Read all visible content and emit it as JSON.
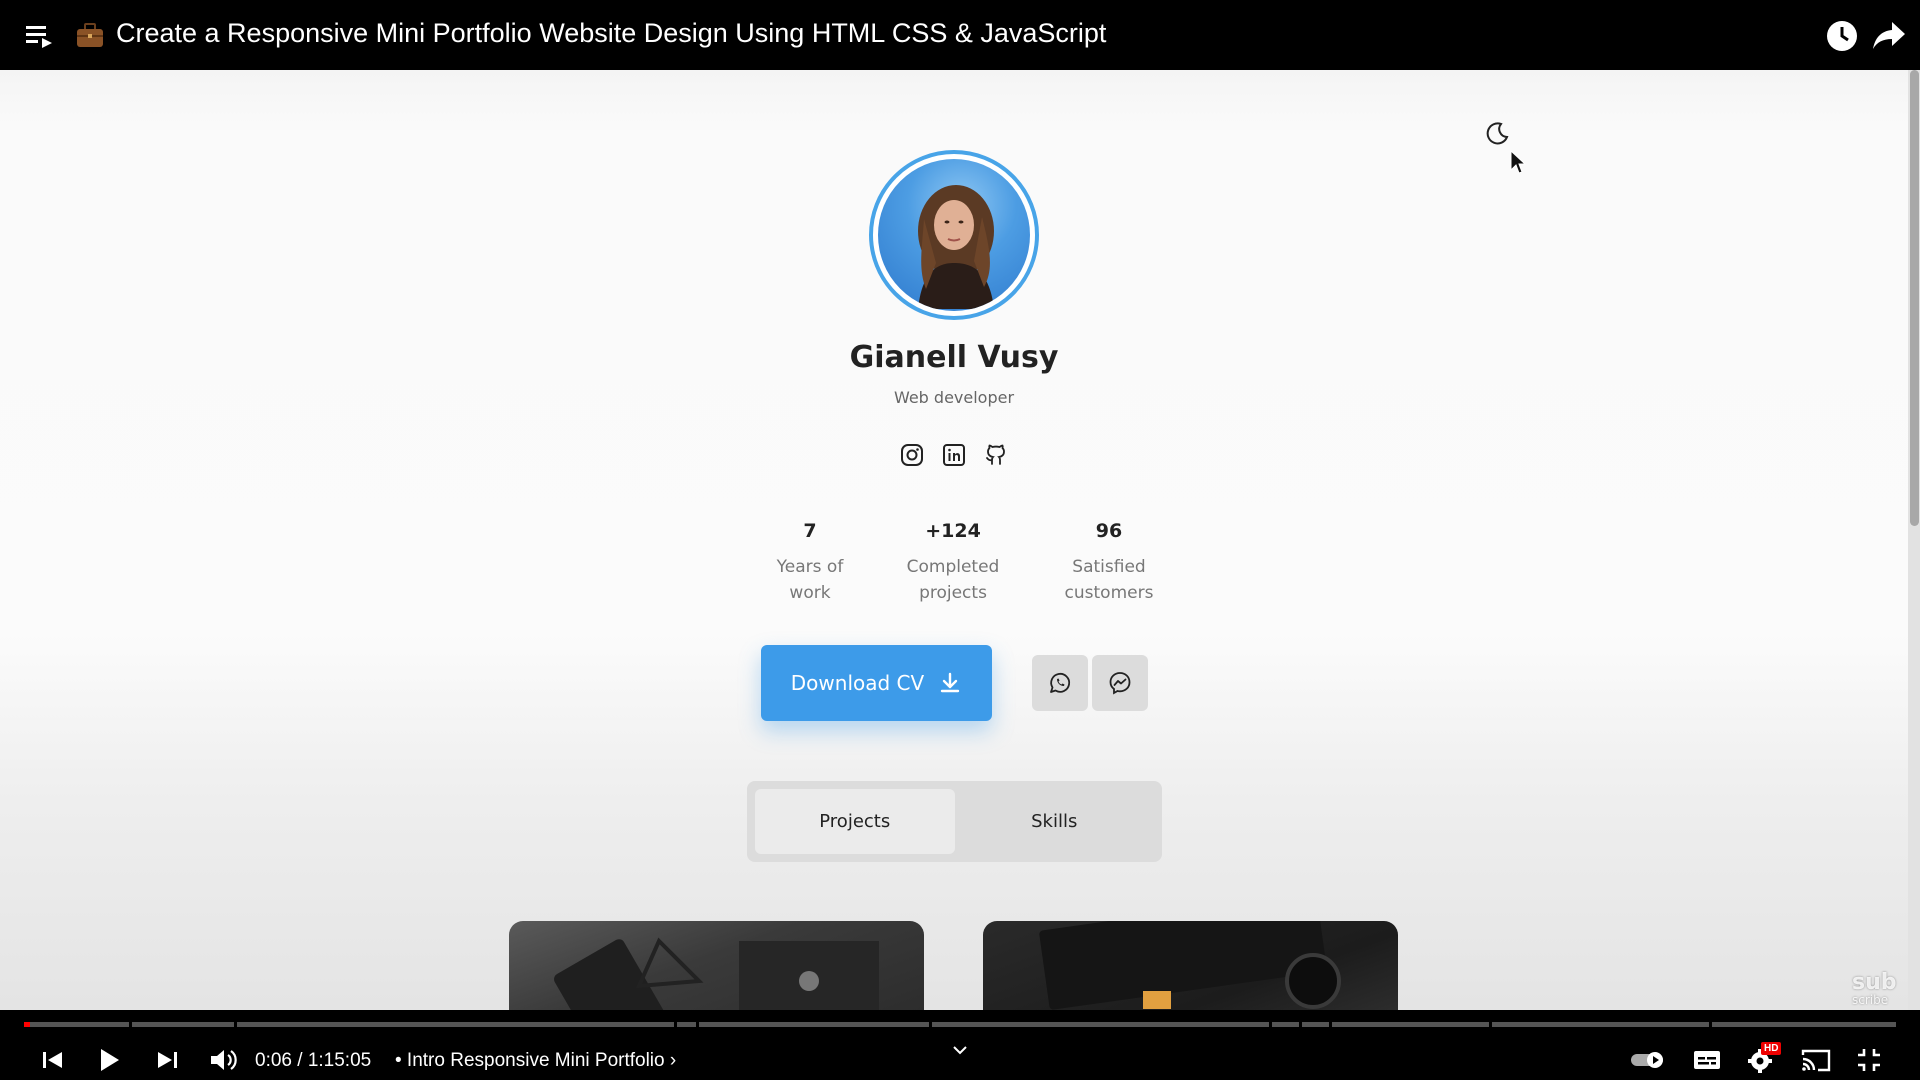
{
  "topbar": {
    "title": "Create a Responsive Mini Portfolio Website Design Using HTML CSS & JavaScript",
    "icons": [
      "playlist-menu-icon",
      "briefcase-icon",
      "watch-later-clock-icon",
      "share-arrow-icon"
    ]
  },
  "profile": {
    "name": "Gianell Vusy",
    "role": "Web developer",
    "socials": [
      "instagram-icon",
      "linkedin-icon",
      "github-icon"
    ]
  },
  "stats": [
    {
      "value": "7",
      "label_line1": "Years of",
      "label_line2": "work"
    },
    {
      "value": "+124",
      "label_line1": "Completed",
      "label_line2": "projects"
    },
    {
      "value": "96",
      "label_line1": "Satisfied",
      "label_line2": "customers"
    }
  ],
  "actions": {
    "download_label": "Download CV",
    "chat_buttons": [
      "whatsapp-icon",
      "messenger-icon"
    ]
  },
  "tabs": [
    {
      "label": "Projects",
      "active": true
    },
    {
      "label": "Skills",
      "active": false
    }
  ],
  "watermark": {
    "line1": "sub",
    "line2": "scribe"
  },
  "player": {
    "time": "0:06 / 1:15:05",
    "chapter": "• Intro Responsive Mini Portfolio ›",
    "hd_badge": "HD",
    "progress_fraction": 0.0013
  },
  "colors": {
    "accent": "#3d9be9",
    "avatar_ring": "#48a4e8",
    "progress": "#ff0000"
  }
}
